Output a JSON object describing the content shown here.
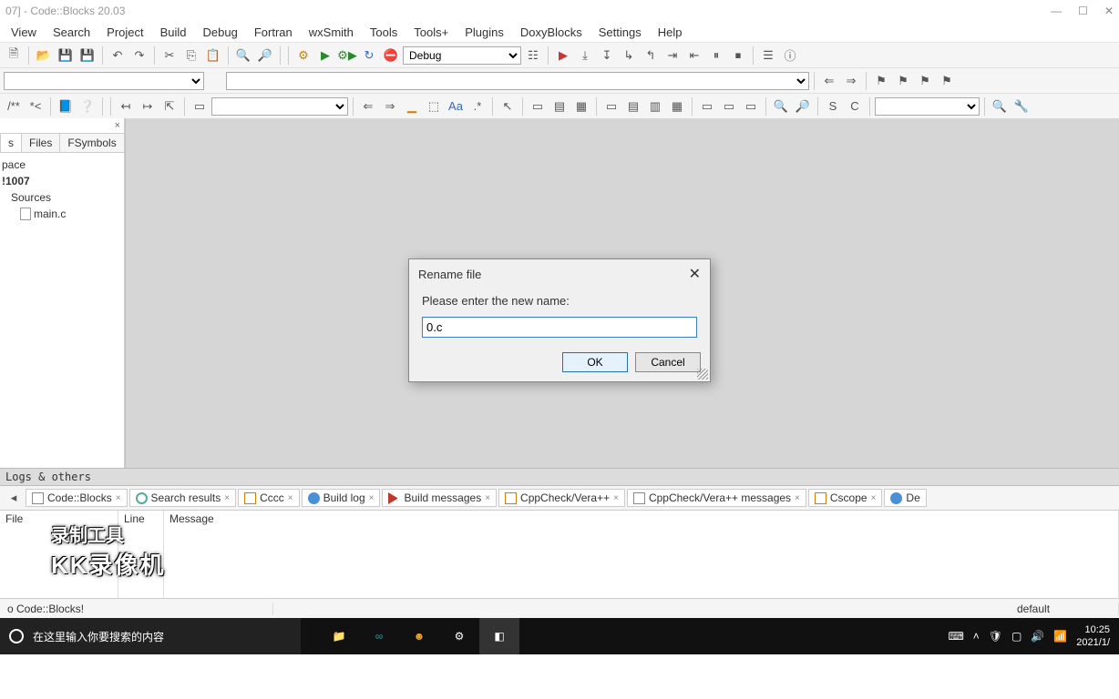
{
  "window": {
    "title": "07] - Code::Blocks 20.03"
  },
  "menu": [
    "View",
    "Search",
    "Project",
    "Build",
    "Debug",
    "Fortran",
    "wxSmith",
    "Tools",
    "Tools+",
    "Plugins",
    "DoxyBlocks",
    "Settings",
    "Help"
  ],
  "toolbar1": {
    "build_config": "Debug"
  },
  "toolbar4": {
    "s_label": "S",
    "c_label": "C"
  },
  "sidepanel": {
    "tabs": [
      "s",
      "Files",
      "FSymbols"
    ],
    "active_tab": 0,
    "tree": {
      "root": "pace",
      "project": "!1007",
      "folder": "Sources",
      "file": "main.c"
    }
  },
  "dialog": {
    "title": "Rename file",
    "prompt": "Please enter the new name:",
    "value": "0.c",
    "ok": "OK",
    "cancel": "Cancel"
  },
  "logs": {
    "header": "Logs & others",
    "tabs": [
      "Code::Blocks",
      "Search results",
      "Cccc",
      "Build log",
      "Build messages",
      "CppCheck/Vera++",
      "CppCheck/Vera++ messages",
      "Cscope",
      "De"
    ],
    "columns": {
      "file": "File",
      "line": "Line",
      "message": "Message"
    }
  },
  "status": {
    "left": "o Code::Blocks!",
    "right": "default"
  },
  "taskbar": {
    "search_placeholder": "在这里输入你要搜索的内容",
    "time": "10:25",
    "date": "2021/1/"
  },
  "watermark": {
    "l1": "录制工具",
    "l2": "KK录像机"
  }
}
